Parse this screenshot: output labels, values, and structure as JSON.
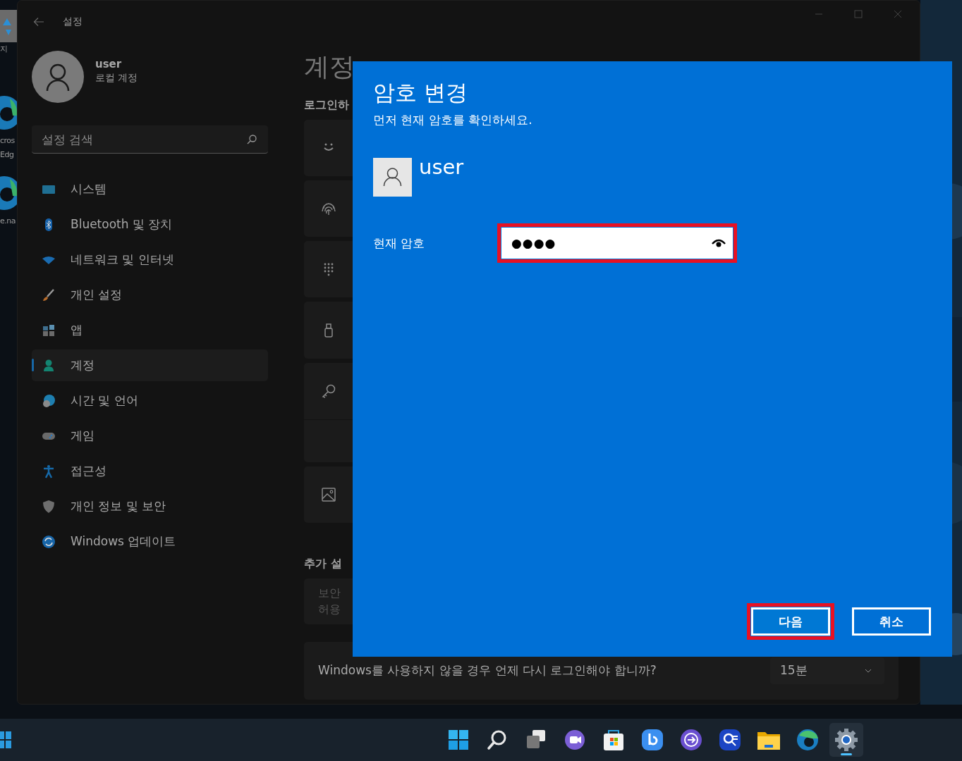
{
  "desktop": {
    "icons": [
      {
        "lines": [
          "지"
        ]
      },
      {
        "lines": [
          "cros",
          "Edg"
        ]
      },
      {
        "lines": [
          "e.na"
        ]
      }
    ]
  },
  "window": {
    "title": "설정"
  },
  "profile": {
    "name": "user",
    "account_type": "로컬 계정"
  },
  "search": {
    "placeholder": "설정 검색"
  },
  "nav": [
    {
      "label": "시스템",
      "selected": false
    },
    {
      "label": "Bluetooth 및 장치",
      "selected": false
    },
    {
      "label": "네트워크 및 인터넷",
      "selected": false
    },
    {
      "label": "개인 설정",
      "selected": false
    },
    {
      "label": "앱",
      "selected": false
    },
    {
      "label": "계정",
      "selected": true
    },
    {
      "label": "시간 및 언어",
      "selected": false
    },
    {
      "label": "게임",
      "selected": false
    },
    {
      "label": "접근성",
      "selected": false
    },
    {
      "label": "개인 정보 및 보안",
      "selected": false
    },
    {
      "label": "Windows 업데이트",
      "selected": false
    }
  ],
  "page": {
    "heading": "계정",
    "section": "로그인하",
    "additional_section": "추가 설",
    "note_lines": [
      "보안",
      "허용"
    ],
    "timeout": {
      "label": "Windows를 사용하지 않을 경우 언제 다시 로그인해야 합니까?",
      "value": "15분"
    }
  },
  "dialog": {
    "title": "암호 변경",
    "subtitle": "먼저 현재 암호를 확인하세요.",
    "user": {
      "name": "user"
    },
    "field": {
      "label": "현재 암호",
      "value": "●●●●",
      "highlighted": true
    },
    "buttons": [
      {
        "label": "다음",
        "highlighted": true
      },
      {
        "label": "취소",
        "highlighted": false
      }
    ]
  },
  "taskbar": {
    "apps": [
      {
        "active": false
      },
      {
        "active": false
      },
      {
        "active": false
      },
      {
        "active": false
      },
      {
        "active": false
      },
      {
        "active": false
      },
      {
        "active": false
      },
      {
        "active": false
      },
      {
        "active": false
      },
      {
        "active": false
      },
      {
        "active": true
      }
    ]
  }
}
